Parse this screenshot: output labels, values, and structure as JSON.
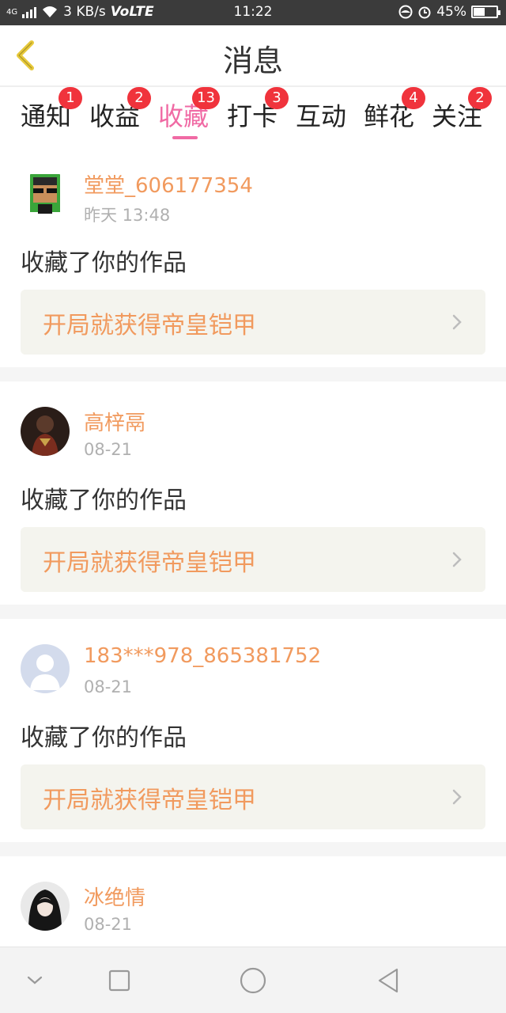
{
  "status_bar": {
    "network_type": "4G",
    "speed": "3 KB/s",
    "volte": "VoLTE",
    "time": "11:22",
    "battery_percent": "45%",
    "battery_level": 0.45
  },
  "header": {
    "title": "消息"
  },
  "tabs": [
    {
      "label": "通知",
      "badge": "1"
    },
    {
      "label": "收益",
      "badge": "2"
    },
    {
      "label": "收藏",
      "badge": "13",
      "active": true
    },
    {
      "label": "打卡",
      "badge": "3"
    },
    {
      "label": "互动",
      "badge": ""
    },
    {
      "label": "鲜花",
      "badge": "4"
    },
    {
      "label": "关注",
      "badge": "2"
    }
  ],
  "feed": [
    {
      "username": "堂堂_606177354",
      "time": "昨天 13:48",
      "action": "收藏了你的作品",
      "work_title": "开局就获得帝皇铠甲",
      "avatar": "pixel-avatar"
    },
    {
      "username": "高梓鬲",
      "time": "08-21",
      "action": "收藏了你的作品",
      "work_title": "开局就获得帝皇铠甲",
      "avatar": "armor-avatar"
    },
    {
      "username": "183***978_865381752",
      "time": "08-21",
      "action": "收藏了你的作品",
      "work_title": "开局就获得帝皇铠甲",
      "avatar": "default-avatar"
    },
    {
      "username": "冰绝情",
      "time": "08-21",
      "action": "",
      "work_title": "",
      "avatar": "hooded-avatar"
    }
  ],
  "colors": {
    "accent_pink": "#f06aa4",
    "username_orange": "#f19a5e",
    "badge_red": "#f0333c",
    "back_arrow_yellow": "#e7c93a"
  }
}
